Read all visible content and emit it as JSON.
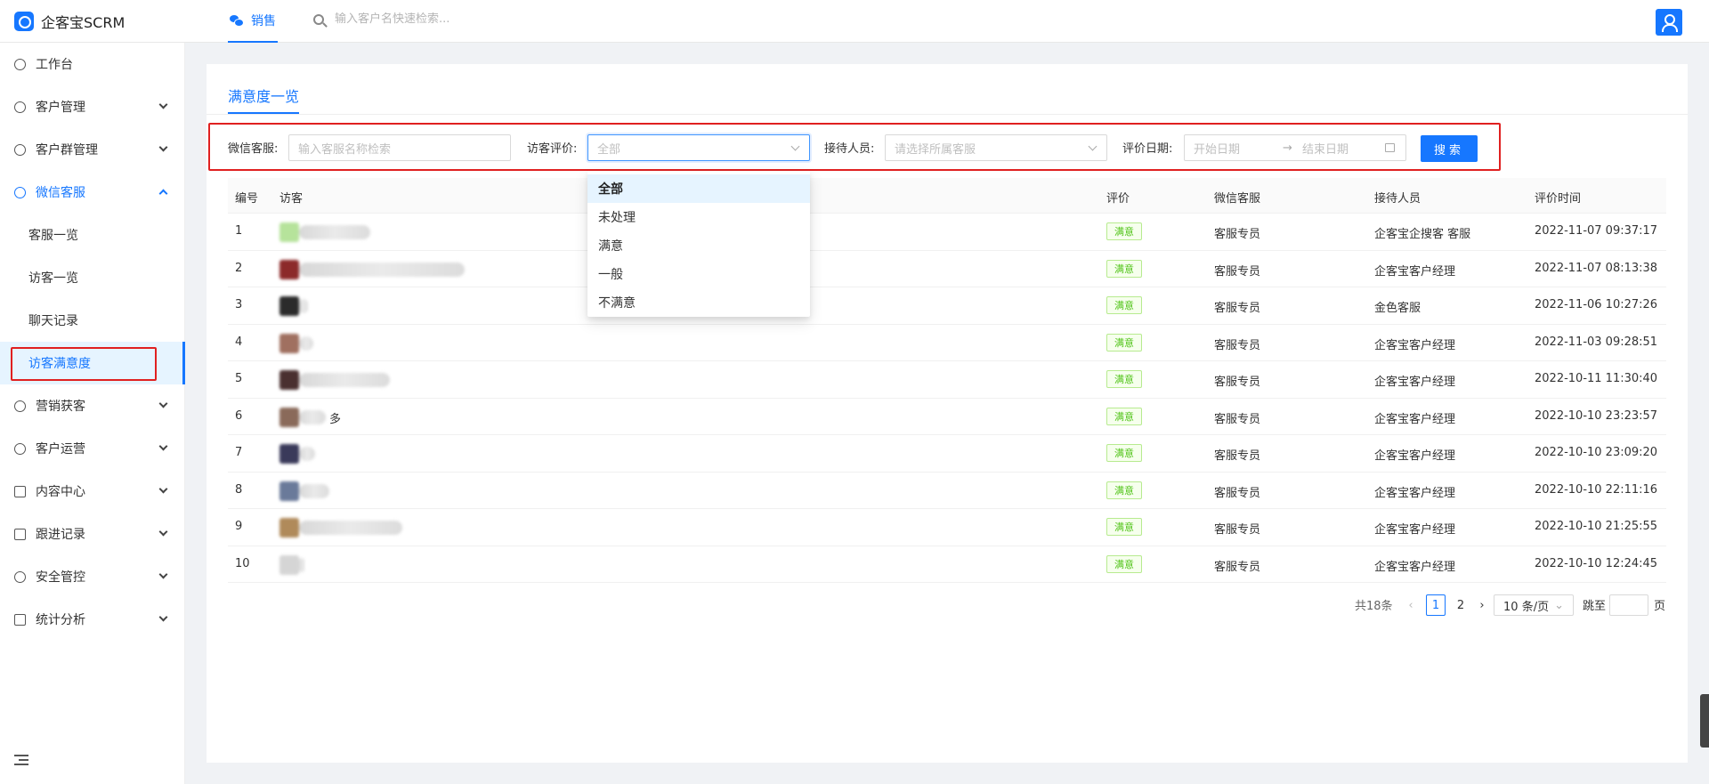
{
  "app": {
    "logo_text": "企客宝SCRM"
  },
  "topbar": {
    "tab_label": "销售",
    "search_placeholder": "输入客户名快速检索..."
  },
  "sidebar": {
    "items": [
      {
        "label": "工作台",
        "icon": "dashboard-icon"
      },
      {
        "label": "客户管理",
        "icon": "customer-icon"
      },
      {
        "label": "客户群管理",
        "icon": "group-chat-icon"
      },
      {
        "label": "微信客服",
        "icon": "wechat-service-icon"
      },
      {
        "label": "营销获客",
        "icon": "bulb-icon"
      },
      {
        "label": "客户运营",
        "icon": "chat-icon"
      },
      {
        "label": "内容中心",
        "icon": "content-icon"
      },
      {
        "label": "跟进记录",
        "icon": "record-icon"
      },
      {
        "label": "安全管控",
        "icon": "shield-icon"
      },
      {
        "label": "统计分析",
        "icon": "chart-icon"
      }
    ],
    "subitems": [
      {
        "label": "客服一览"
      },
      {
        "label": "访客一览"
      },
      {
        "label": "聊天记录"
      },
      {
        "label": "访客满意度"
      }
    ]
  },
  "page": {
    "tab_title": "满意度一览"
  },
  "filters": {
    "wechat_label": "微信客服:",
    "wechat_placeholder": "输入客服名称检索",
    "rating_label": "访客评价:",
    "rating_value": "全部",
    "staff_label": "接待人员:",
    "staff_placeholder": "请选择所属客服",
    "date_label": "评价日期:",
    "date_start": "开始日期",
    "date_arrow": "→",
    "date_end": "结束日期",
    "search_button": "搜索"
  },
  "dropdown": {
    "options": [
      "全部",
      "未处理",
      "满意",
      "一般",
      "不满意"
    ]
  },
  "table": {
    "headers": [
      "编号",
      "访客",
      "评价",
      "微信客服",
      "接待人员",
      "评价时间"
    ],
    "rows": [
      {
        "id": "1",
        "visitor_tail": "",
        "rating": "满意",
        "service": "客服专员",
        "staff": "企客宝企搜客 客服",
        "time": "2022-11-07 09:37:17"
      },
      {
        "id": "2",
        "visitor_tail": "",
        "rating": "满意",
        "service": "客服专员",
        "staff": "企客宝客户经理",
        "time": "2022-11-07 08:13:38"
      },
      {
        "id": "3",
        "visitor_tail": "",
        "rating": "满意",
        "service": "客服专员",
        "staff": "金色客服",
        "time": "2022-11-06 10:27:26"
      },
      {
        "id": "4",
        "visitor_tail": "",
        "rating": "满意",
        "service": "客服专员",
        "staff": "企客宝客户经理",
        "time": "2022-11-03 09:28:51"
      },
      {
        "id": "5",
        "visitor_tail": "",
        "rating": "满意",
        "service": "客服专员",
        "staff": "企客宝客户经理",
        "time": "2022-10-11 11:30:40"
      },
      {
        "id": "6",
        "visitor_tail": "多",
        "rating": "满意",
        "service": "客服专员",
        "staff": "企客宝客户经理",
        "time": "2022-10-10 23:23:57"
      },
      {
        "id": "7",
        "visitor_tail": "",
        "rating": "满意",
        "service": "客服专员",
        "staff": "企客宝客户经理",
        "time": "2022-10-10 23:09:20"
      },
      {
        "id": "8",
        "visitor_tail": "",
        "rating": "满意",
        "service": "客服专员",
        "staff": "企客宝客户经理",
        "time": "2022-10-10 22:11:16"
      },
      {
        "id": "9",
        "visitor_tail": "",
        "rating": "满意",
        "service": "客服专员",
        "staff": "企客宝客户经理",
        "time": "2022-10-10 21:25:55"
      },
      {
        "id": "10",
        "visitor_tail": "",
        "rating": "满意",
        "service": "客服专员",
        "staff": "企客宝客户经理",
        "time": "2022-10-10 12:24:45"
      }
    ]
  },
  "pagination": {
    "total": "共18条",
    "pages": [
      "1",
      "2"
    ],
    "page_size": "10 条/页",
    "jump_label": "跳至",
    "page_suffix": "页"
  },
  "colors": {
    "primary": "#1677ff",
    "highlight": "#e02020",
    "tag_green": "#52c41a"
  }
}
